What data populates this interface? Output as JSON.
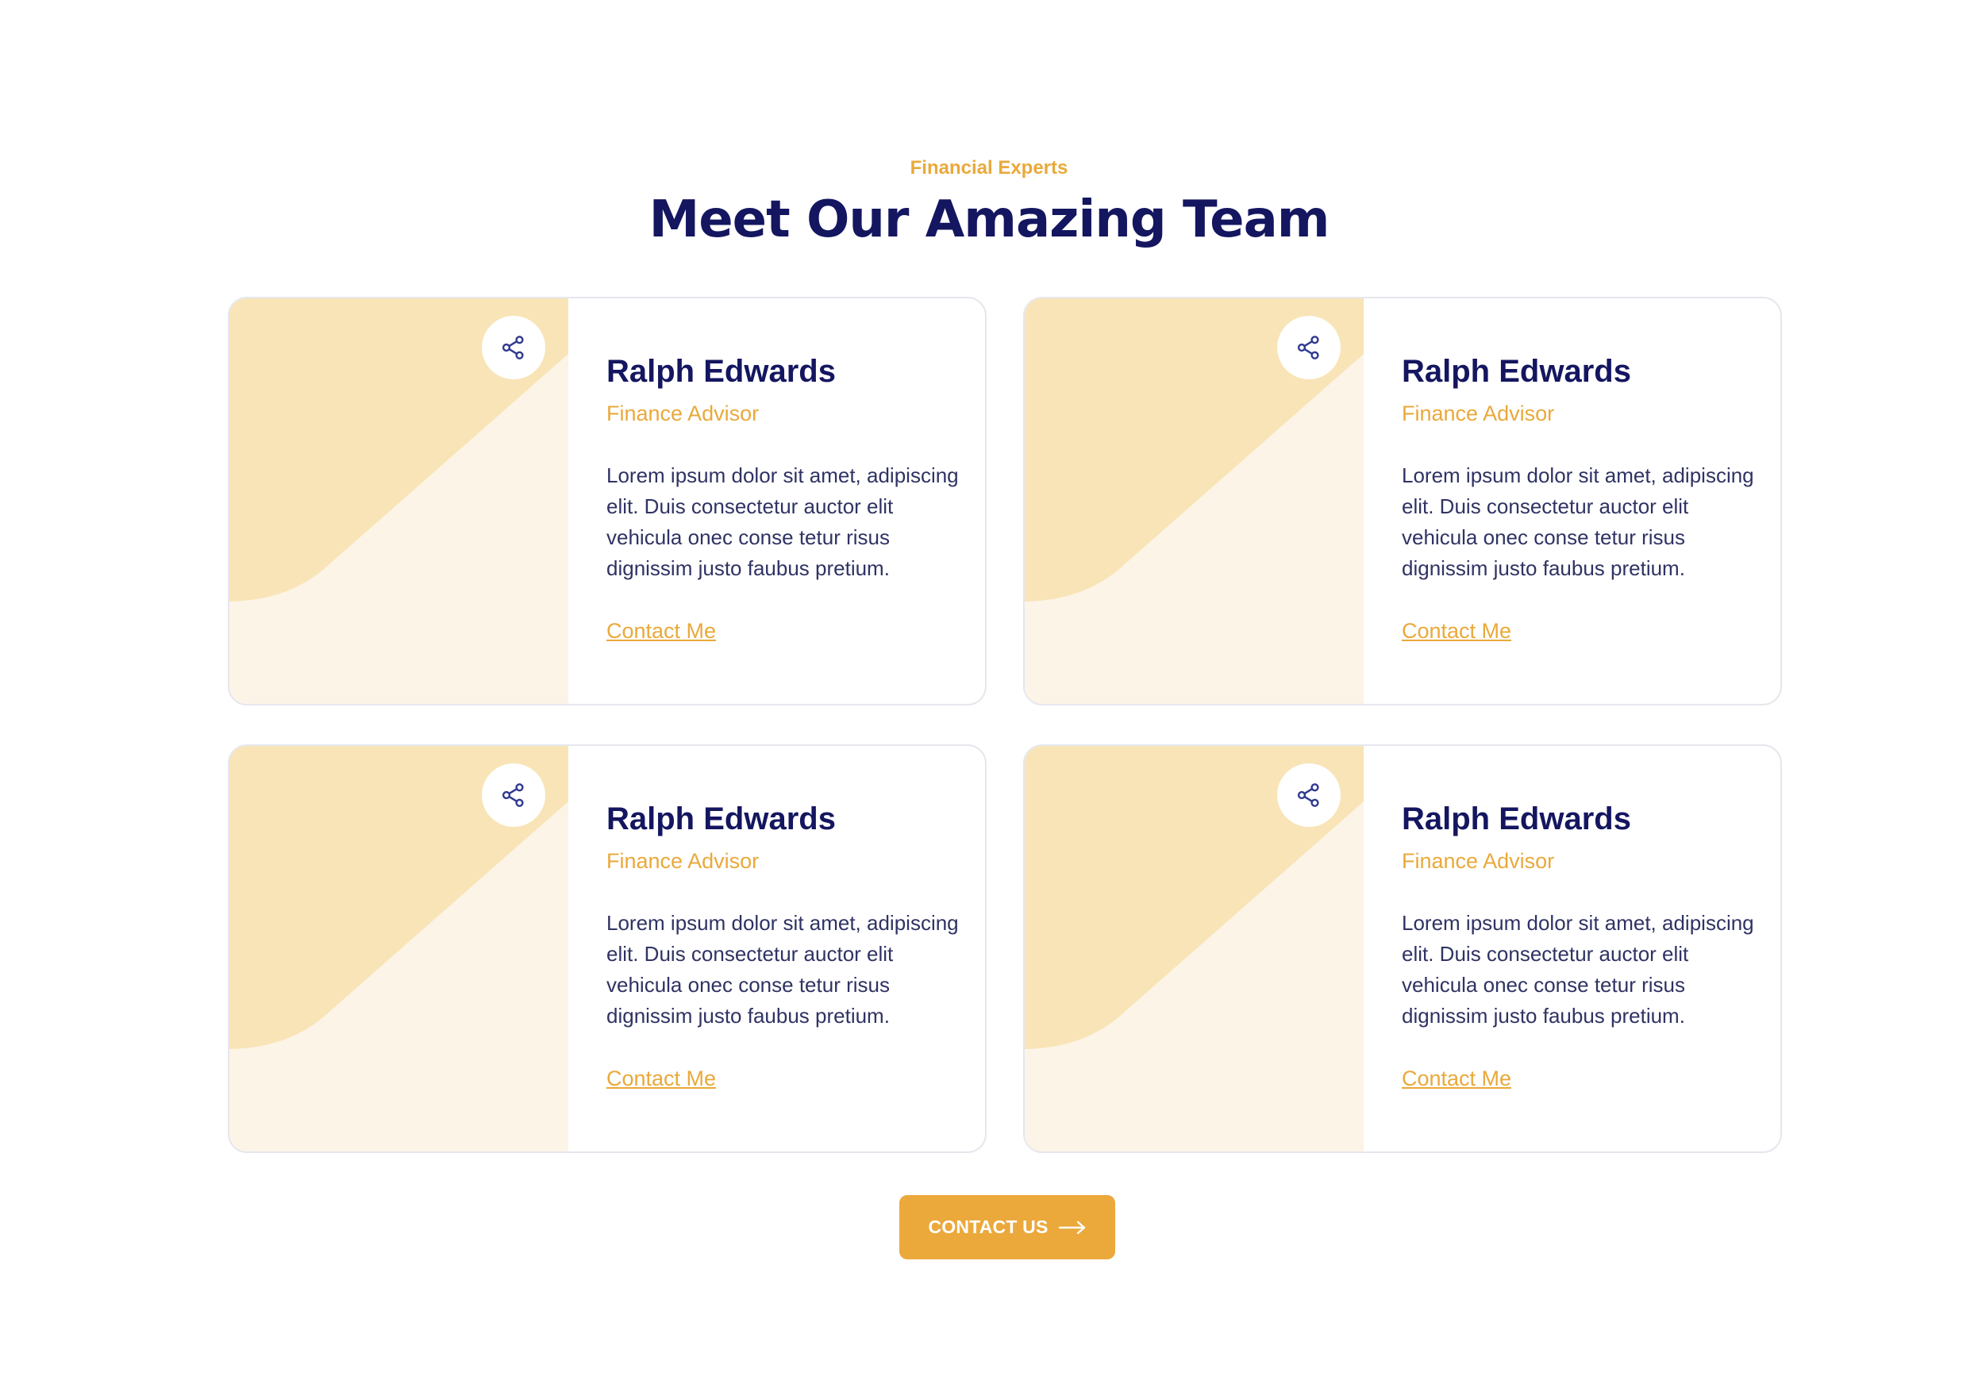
{
  "section": {
    "eyebrow": "Financial Experts",
    "title": "Meet Our Amazing Team"
  },
  "team": [
    {
      "name": "Ralph Edwards",
      "role": "Finance Advisor",
      "bio": "Lorem ipsum dolor sit amet, adipiscing elit. Duis consectetur auctor elit vehicula onec conse tetur risus dignissim justo faubus pretium.",
      "link_label": "Contact Me",
      "share_icon": "share-icon"
    },
    {
      "name": "Ralph Edwards",
      "role": "Finance Advisor",
      "bio": "Lorem ipsum dolor sit amet, adipiscing elit. Duis consectetur auctor elit vehicula onec conse tetur risus dignissim justo faubus pretium.",
      "link_label": "Contact Me",
      "share_icon": "share-icon"
    },
    {
      "name": "Ralph Edwards",
      "role": "Finance Advisor",
      "bio": "Lorem ipsum dolor sit amet, adipiscing elit. Duis consectetur auctor elit vehicula onec conse tetur risus dignissim justo faubus pretium.",
      "link_label": "Contact Me",
      "share_icon": "share-icon"
    },
    {
      "name": "Ralph Edwards",
      "role": "Finance Advisor",
      "bio": "Lorem ipsum dolor sit amet, adipiscing elit. Duis consectetur auctor elit vehicula onec conse tetur risus dignissim justo faubus pretium.",
      "link_label": "Contact Me",
      "share_icon": "share-icon"
    }
  ],
  "cta": {
    "label": "CONTACT US",
    "icon": "arrow-right-icon"
  },
  "colors": {
    "accent": "#e9a93b",
    "navy": "#141660",
    "text": "#2f3363",
    "shape_dark": "#f8e4b6",
    "shape_light": "#fcf4e6",
    "border": "#e6e7ee"
  }
}
